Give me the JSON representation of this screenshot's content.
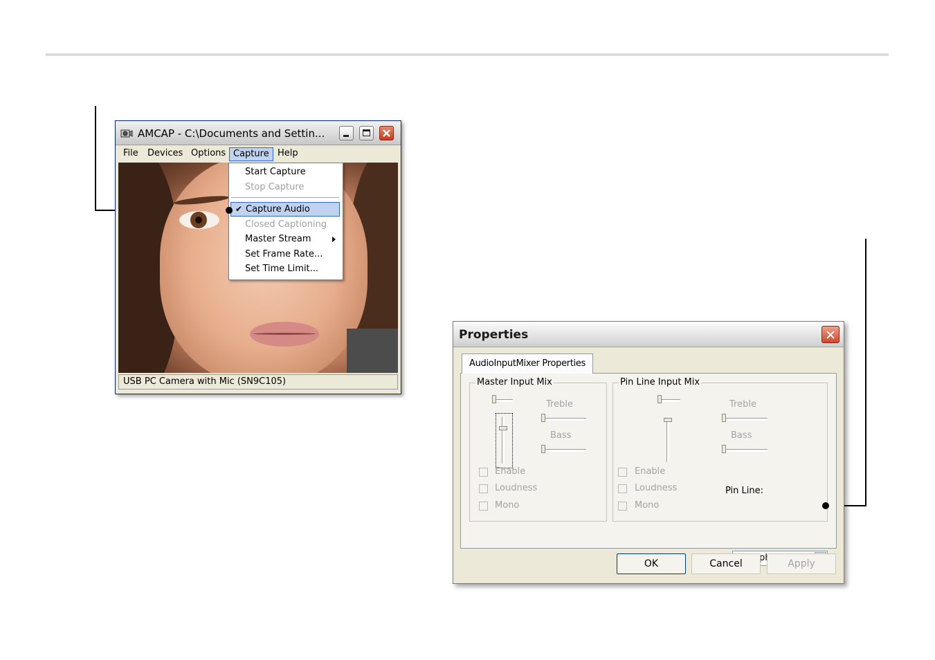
{
  "amcap": {
    "title": "AMCAP - C:\\Documents and Settin...",
    "menu": [
      "File",
      "Devices",
      "Options",
      "Capture",
      "Help"
    ],
    "active_menu": "Capture",
    "status": "USB PC Camera with Mic (SN9C105)",
    "capture_menu": {
      "items": [
        {
          "label": "Start Capture",
          "enabled": true
        },
        {
          "label": "Stop Capture",
          "enabled": false
        },
        {
          "label": "Capture Audio",
          "enabled": true,
          "checked": true,
          "highlighted": true
        },
        {
          "label": "Closed Captioning",
          "enabled": false
        },
        {
          "label": "Master Stream",
          "enabled": true,
          "submenu": true
        },
        {
          "label": "Set Frame Rate...",
          "enabled": true
        },
        {
          "label": "Set Time Limit...",
          "enabled": true
        }
      ]
    }
  },
  "properties": {
    "title": "Properties",
    "tab": "AudioInputMixer Properties",
    "master_group": {
      "label": "Master Input Mix",
      "treble": "Treble",
      "bass": "Bass",
      "enable": "Enable",
      "loudness": "Loudness",
      "mono": "Mono"
    },
    "pin_group": {
      "label": "Pin Line Input Mix",
      "treble": "Treble",
      "bass": "Bass",
      "enable": "Enable",
      "loudness": "Loudness",
      "mono": "Mono",
      "pin_line_label": "Pin Line:",
      "pin_line_value": "Microphone"
    },
    "buttons": {
      "ok": "OK",
      "cancel": "Cancel",
      "apply": "Apply"
    }
  }
}
